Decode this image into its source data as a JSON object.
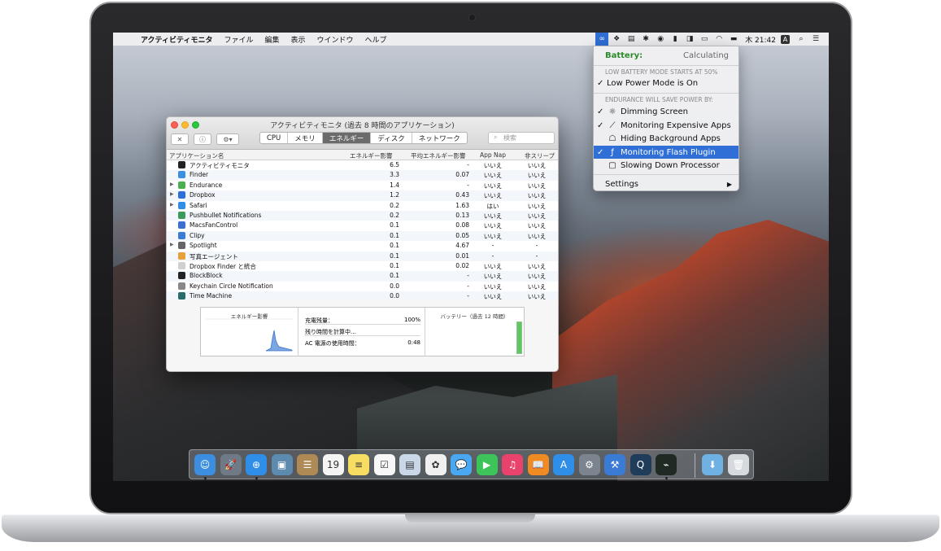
{
  "menubar": {
    "app_name": "アクティビティモニタ",
    "items": [
      "ファイル",
      "編集",
      "表示",
      "ウインドウ",
      "ヘルプ"
    ],
    "clock": "木 21:42",
    "input_indicator": "A"
  },
  "endurance_menu": {
    "battery_label": "Battery:",
    "battery_value": "Calculating",
    "low_battery_caption": "LOW BATTERY MODE STARTS AT 50%",
    "low_power_item": "Low Power Mode is On",
    "save_caption": "ENDURANCE WILL SAVE POWER BY:",
    "items": [
      {
        "label": "Dimming Screen",
        "checked": true,
        "icon": "sun-icon"
      },
      {
        "label": "Monitoring Expensive Apps",
        "checked": true,
        "icon": "chart-icon"
      },
      {
        "label": "Hiding Background Apps",
        "checked": false,
        "icon": "ghost-icon"
      },
      {
        "label": "Monitoring Flash Plugin",
        "checked": true,
        "icon": "flash-icon",
        "selected": true
      },
      {
        "label": "Slowing Down Processor",
        "checked": false,
        "icon": "chip-icon"
      }
    ],
    "settings_label": "Settings",
    "check_glyph": "✓",
    "arrow_glyph": "▶"
  },
  "activity_monitor": {
    "title": "アクティビティモニタ (過去 8 時間のアプリケーション)",
    "tabs": [
      "CPU",
      "メモリ",
      "エネルギー",
      "ディスク",
      "ネットワーク"
    ],
    "active_tab": "エネルギー",
    "search_placeholder": "検索",
    "columns": [
      "アプリケーション名",
      "エネルギー影響",
      "平均エネルギー影響",
      "App Nap",
      "非スリープ"
    ],
    "rows": [
      {
        "name": "アクティビティモニタ",
        "impact": "6.5",
        "avg": "-",
        "nap": "いいえ",
        "sleep": "いいえ",
        "expand": false,
        "color": "#222222"
      },
      {
        "name": "Finder",
        "impact": "3.3",
        "avg": "0.07",
        "nap": "いいえ",
        "sleep": "いいえ",
        "expand": false,
        "color": "#3b8ee0"
      },
      {
        "name": "Endurance",
        "impact": "1.4",
        "avg": "-",
        "nap": "いいえ",
        "sleep": "いいえ",
        "expand": true,
        "color": "#4caf50"
      },
      {
        "name": "Dropbox",
        "impact": "1.2",
        "avg": "0.43",
        "nap": "いいえ",
        "sleep": "いいえ",
        "expand": true,
        "color": "#2d6fd8"
      },
      {
        "name": "Safari",
        "impact": "0.2",
        "avg": "1.63",
        "nap": "はい",
        "sleep": "いいえ",
        "expand": true,
        "color": "#2f8ee8"
      },
      {
        "name": "Pushbullet Notifications",
        "impact": "0.2",
        "avg": "0.13",
        "nap": "いいえ",
        "sleep": "いいえ",
        "expand": false,
        "color": "#3a9b5c"
      },
      {
        "name": "MacsFanControl",
        "impact": "0.1",
        "avg": "0.08",
        "nap": "いいえ",
        "sleep": "いいえ",
        "expand": false,
        "color": "#3c6fd0"
      },
      {
        "name": "Clipy",
        "impact": "0.1",
        "avg": "0.05",
        "nap": "いいえ",
        "sleep": "いいえ",
        "expand": false,
        "color": "#3c7bd4"
      },
      {
        "name": "Spotlight",
        "impact": "0.1",
        "avg": "4.67",
        "nap": "-",
        "sleep": "-",
        "expand": true,
        "color": "#666666"
      },
      {
        "name": "写真エージェント",
        "impact": "0.1",
        "avg": "0.01",
        "nap": "-",
        "sleep": "-",
        "expand": false,
        "color": "#e8a13a"
      },
      {
        "name": "Dropbox Finder と統合",
        "impact": "0.1",
        "avg": "0.02",
        "nap": "いいえ",
        "sleep": "いいえ",
        "expand": false,
        "color": "#d0d0d0"
      },
      {
        "name": "BlockBlock",
        "impact": "0.1",
        "avg": "-",
        "nap": "いいえ",
        "sleep": "いいえ",
        "expand": false,
        "color": "#222222"
      },
      {
        "name": "Keychain Circle Notification",
        "impact": "0.0",
        "avg": "-",
        "nap": "いいえ",
        "sleep": "いいえ",
        "expand": false,
        "color": "#888888"
      },
      {
        "name": "Time Machine",
        "impact": "0.0",
        "avg": "-",
        "nap": "いいえ",
        "sleep": "いいえ",
        "expand": false,
        "color": "#2a6b6b"
      }
    ],
    "bottom": {
      "graph_label": "エネルギー影響",
      "charge_label": "充電残量：",
      "charge_value": "100%",
      "remaining_label": "残り時間を計算中...",
      "ac_label": "AC 電源の使用時間：",
      "ac_value": "0:48",
      "battery_graph_label": "バッテリー（過去 12 時間）",
      "battery_level": 1.0
    }
  },
  "dock": {
    "apps": [
      {
        "name": "finder-dock-icon",
        "color": "#3b8ee0",
        "glyph": "☺",
        "running": true
      },
      {
        "name": "launchpad-dock-icon",
        "color": "#6f7a86",
        "glyph": "🚀",
        "running": false
      },
      {
        "name": "safari-dock-icon",
        "color": "#2f8ee8",
        "glyph": "⊕",
        "running": true
      },
      {
        "name": "preview-dock-icon",
        "color": "#5d8bb0",
        "glyph": "▣",
        "running": false
      },
      {
        "name": "contacts-dock-icon",
        "color": "#b08a55",
        "glyph": "☰",
        "running": false
      },
      {
        "name": "calendar-dock-icon",
        "color": "#f4f4f4",
        "glyph": "19",
        "running": false
      },
      {
        "name": "notes-dock-icon",
        "color": "#f7dd61",
        "glyph": "≡",
        "running": false
      },
      {
        "name": "reminders-dock-icon",
        "color": "#f7f7f7",
        "glyph": "☑",
        "running": false
      },
      {
        "name": "preview2-dock-icon",
        "color": "#c9d7e6",
        "glyph": "▤",
        "running": false
      },
      {
        "name": "photos-dock-icon",
        "color": "#f0f0f0",
        "glyph": "✿",
        "running": false
      },
      {
        "name": "messages-dock-icon",
        "color": "#4aa8f2",
        "glyph": "💬",
        "running": false
      },
      {
        "name": "facetime-dock-icon",
        "color": "#3cc45a",
        "glyph": "▶",
        "running": false
      },
      {
        "name": "itunes-dock-icon",
        "color": "#e9426d",
        "glyph": "♫",
        "running": false
      },
      {
        "name": "ibooks-dock-icon",
        "color": "#f08a22",
        "glyph": "📖",
        "running": false
      },
      {
        "name": "appstore-dock-icon",
        "color": "#2f8ee8",
        "glyph": "A",
        "running": false
      },
      {
        "name": "system-preferences-dock-icon",
        "color": "#7c8490",
        "glyph": "⚙",
        "running": false
      },
      {
        "name": "xcode-dock-icon",
        "color": "#3a7bd5",
        "glyph": "⚒",
        "running": false
      },
      {
        "name": "quicktime-dock-icon",
        "color": "#1f3c5a",
        "glyph": "Q",
        "running": false
      },
      {
        "name": "activity-monitor-dock-icon",
        "color": "#1f2a24",
        "glyph": "⌁",
        "running": true
      }
    ],
    "trailing": [
      {
        "name": "downloads-dock-icon",
        "color": "#6eb1e2",
        "glyph": "⬇"
      },
      {
        "name": "trash-dock-icon",
        "color": "#d6d9dd",
        "glyph": "🗑"
      }
    ]
  }
}
